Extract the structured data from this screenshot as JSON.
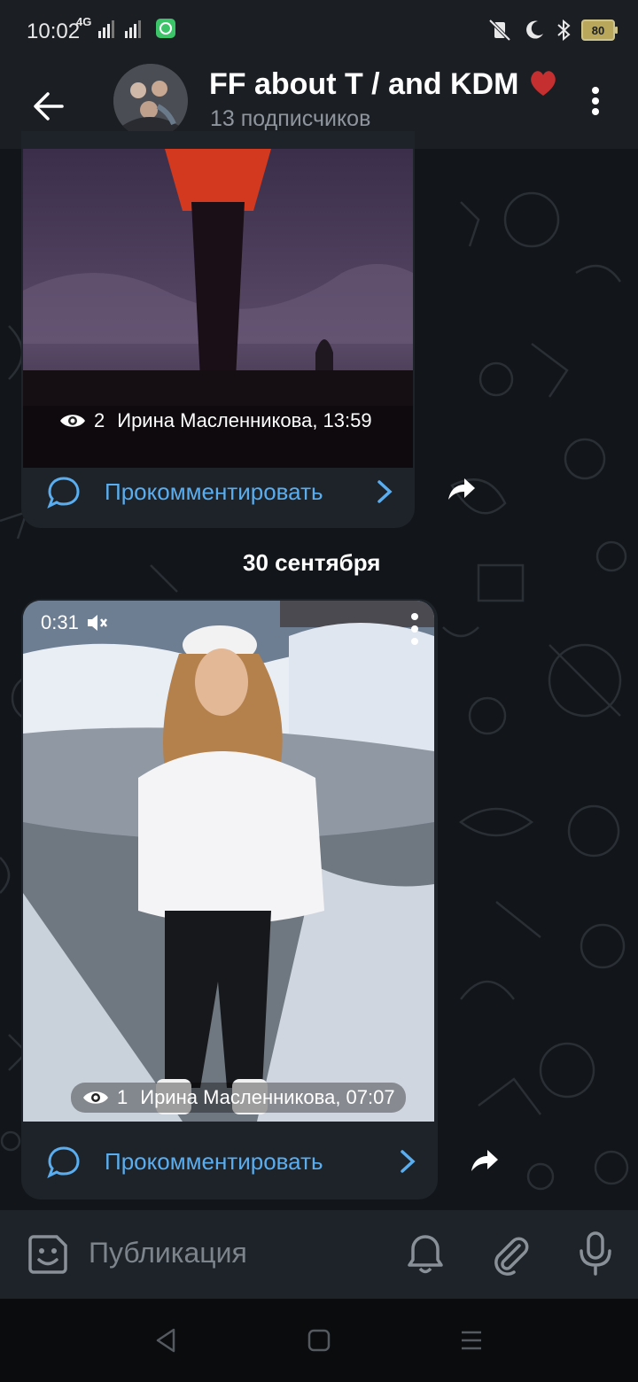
{
  "status_bar": {
    "time": "10:02",
    "network": "4G",
    "battery": "80"
  },
  "header": {
    "title": "FF about T / and KDM",
    "subtitle": "13 подписчиков"
  },
  "messages": [
    {
      "views": "2",
      "author_time": "Ирина Масленникова, 13:59",
      "comment_label": "Прокомментировать"
    },
    {
      "video_duration": "0:31",
      "views": "1",
      "author_time": "Ирина Масленникова, 07:07",
      "comment_label": "Прокомментировать"
    }
  ],
  "date_separator": "30 сентября",
  "input": {
    "placeholder": "Публикация"
  },
  "colors": {
    "accent": "#5aaef0",
    "header_bg": "#1b1f24",
    "bubble_bg": "#1e2329",
    "heart": "#d93636"
  }
}
